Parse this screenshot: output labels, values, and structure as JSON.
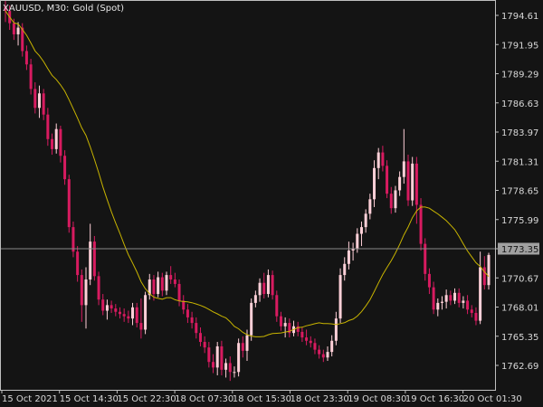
{
  "chart_data": {
    "type": "candlestick",
    "symbol": "XAUUSD",
    "timeframe": "M30",
    "instrument": "Gold (Spot)",
    "title_separator_1": ",",
    "title_separator_2": ":",
    "y_ticks": [
      "1794.61",
      "1791.95",
      "1789.29",
      "1786.63",
      "1783.97",
      "1781.31",
      "1778.65",
      "1775.99",
      "1773.35",
      "1770.67",
      "1768.01",
      "1765.35",
      "1762.69"
    ],
    "x_ticks": [
      "15 Oct 2021",
      "15 Oct 14:30",
      "15 Oct 22:30",
      "18 Oct 07:30",
      "18 Oct 15:30",
      "18 Oct 23:30",
      "19 Oct 08:30",
      "19 Oct 16:30",
      "20 Oct 01:30"
    ],
    "current_price": "1773.35",
    "ylim": [
      1761.0,
      1795.9
    ],
    "colors": {
      "background": "#141414",
      "bull": "#ffd0d8",
      "bear": "#d81b60",
      "ma_line": "#c8b400",
      "price_line": "#8a8a8a",
      "price_label_bg": "#a0a0a0",
      "frame": "#bfbfbf"
    },
    "moving_average_period": 20,
    "candles": [
      [
        1795.4,
        1795.9,
        1794.0,
        1795.0
      ],
      [
        1795.0,
        1795.5,
        1793.3,
        1793.9
      ],
      [
        1793.9,
        1794.3,
        1792.4,
        1792.9
      ],
      [
        1792.9,
        1794.0,
        1791.9,
        1793.5
      ],
      [
        1793.5,
        1793.9,
        1790.9,
        1791.4
      ],
      [
        1791.4,
        1791.9,
        1789.7,
        1790.2
      ],
      [
        1790.2,
        1790.7,
        1787.5,
        1788.0
      ],
      [
        1788.0,
        1788.6,
        1785.8,
        1786.3
      ],
      [
        1786.3,
        1788.3,
        1785.4,
        1787.6
      ],
      [
        1787.6,
        1788.0,
        1785.2,
        1785.7
      ],
      [
        1785.7,
        1786.3,
        1782.9,
        1783.5
      ],
      [
        1783.5,
        1784.0,
        1782.1,
        1782.6
      ],
      [
        1782.6,
        1784.9,
        1782.2,
        1784.4
      ],
      [
        1784.4,
        1784.7,
        1781.4,
        1782.0
      ],
      [
        1782.0,
        1782.5,
        1779.4,
        1779.9
      ],
      [
        1779.9,
        1780.3,
        1775.1,
        1775.6
      ],
      [
        1775.6,
        1776.1,
        1772.9,
        1773.4
      ],
      [
        1773.4,
        1773.9,
        1770.7,
        1771.3
      ],
      [
        1771.3,
        1771.8,
        1767.1,
        1768.6
      ],
      [
        1768.6,
        1772.0,
        1766.5,
        1770.9
      ],
      [
        1770.9,
        1775.9,
        1770.4,
        1774.3
      ],
      [
        1774.3,
        1774.8,
        1770.8,
        1771.2
      ],
      [
        1771.2,
        1771.6,
        1768.6,
        1769.1
      ],
      [
        1769.1,
        1769.6,
        1767.7,
        1768.1
      ],
      [
        1768.1,
        1769.1,
        1767.3,
        1768.6
      ],
      [
        1768.6,
        1769.0,
        1767.9,
        1768.3
      ],
      [
        1768.3,
        1768.7,
        1767.6,
        1768.0
      ],
      [
        1768.0,
        1768.4,
        1767.4,
        1767.8
      ],
      [
        1767.8,
        1768.3,
        1767.1,
        1767.6
      ],
      [
        1767.6,
        1768.1,
        1767.0,
        1767.4
      ],
      [
        1767.4,
        1768.8,
        1766.8,
        1768.4
      ],
      [
        1768.4,
        1768.8,
        1766.6,
        1767.0
      ],
      [
        1767.0,
        1769.2,
        1765.6,
        1766.4
      ],
      [
        1766.4,
        1769.8,
        1766.0,
        1769.5
      ],
      [
        1769.5,
        1771.4,
        1769.1,
        1770.9
      ],
      [
        1770.9,
        1771.3,
        1769.0,
        1769.6
      ],
      [
        1769.6,
        1771.6,
        1769.3,
        1771.1
      ],
      [
        1771.1,
        1771.5,
        1769.4,
        1769.9
      ],
      [
        1769.9,
        1771.6,
        1769.5,
        1771.3
      ],
      [
        1771.3,
        1772.1,
        1770.5,
        1770.9
      ],
      [
        1770.9,
        1771.5,
        1770.2,
        1770.5
      ],
      [
        1770.5,
        1770.9,
        1768.5,
        1769.0
      ],
      [
        1769.0,
        1769.5,
        1767.8,
        1768.2
      ],
      [
        1768.2,
        1768.7,
        1767.0,
        1767.5
      ],
      [
        1767.5,
        1768.0,
        1766.5,
        1767.0
      ],
      [
        1767.0,
        1767.5,
        1765.6,
        1766.1
      ],
      [
        1766.1,
        1766.6,
        1764.9,
        1765.3
      ],
      [
        1765.3,
        1765.8,
        1764.3,
        1764.8
      ],
      [
        1764.8,
        1765.3,
        1763.0,
        1763.5
      ],
      [
        1763.5,
        1764.2,
        1762.5,
        1763.0
      ],
      [
        1763.0,
        1765.3,
        1762.3,
        1764.9
      ],
      [
        1764.9,
        1765.4,
        1762.3,
        1762.8
      ],
      [
        1762.8,
        1763.8,
        1762.1,
        1763.4
      ],
      [
        1763.4,
        1764.0,
        1761.8,
        1762.6
      ],
      [
        1762.6,
        1763.1,
        1762.1,
        1762.6
      ],
      [
        1762.6,
        1765.6,
        1762.2,
        1765.2
      ],
      [
        1765.2,
        1765.8,
        1763.9,
        1764.5
      ],
      [
        1764.5,
        1766.4,
        1763.6,
        1765.9
      ],
      [
        1765.9,
        1769.2,
        1765.4,
        1768.8
      ],
      [
        1768.8,
        1769.9,
        1768.4,
        1769.5
      ],
      [
        1769.5,
        1771.0,
        1768.9,
        1770.6
      ],
      [
        1770.6,
        1771.5,
        1769.2,
        1769.6
      ],
      [
        1769.6,
        1771.8,
        1769.3,
        1771.3
      ],
      [
        1771.3,
        1771.7,
        1769.1,
        1769.5
      ],
      [
        1769.5,
        1769.9,
        1767.1,
        1767.6
      ],
      [
        1767.6,
        1768.0,
        1766.3,
        1766.7
      ],
      [
        1766.7,
        1767.5,
        1765.7,
        1767.0
      ],
      [
        1767.0,
        1767.4,
        1765.7,
        1766.1
      ],
      [
        1766.1,
        1767.2,
        1765.8,
        1766.7
      ],
      [
        1766.7,
        1767.1,
        1765.8,
        1766.2
      ],
      [
        1766.2,
        1766.6,
        1765.3,
        1765.7
      ],
      [
        1765.7,
        1766.4,
        1765.0,
        1765.4
      ],
      [
        1765.4,
        1765.8,
        1764.8,
        1765.2
      ],
      [
        1765.2,
        1765.6,
        1764.2,
        1764.6
      ],
      [
        1764.6,
        1765.0,
        1763.8,
        1764.2
      ],
      [
        1764.2,
        1764.6,
        1763.5,
        1763.9
      ],
      [
        1763.9,
        1764.9,
        1763.6,
        1764.4
      ],
      [
        1764.4,
        1765.9,
        1764.0,
        1765.4
      ],
      [
        1765.4,
        1768.0,
        1765.0,
        1767.4
      ],
      [
        1767.4,
        1771.9,
        1767.0,
        1771.3
      ],
      [
        1771.3,
        1772.9,
        1770.8,
        1772.3
      ],
      [
        1772.3,
        1774.3,
        1771.8,
        1773.5
      ],
      [
        1773.5,
        1774.2,
        1772.6,
        1773.7
      ],
      [
        1773.7,
        1775.5,
        1773.3,
        1775.0
      ],
      [
        1775.0,
        1776.1,
        1773.9,
        1775.6
      ],
      [
        1775.6,
        1777.2,
        1775.1,
        1776.8
      ],
      [
        1776.8,
        1778.6,
        1776.3,
        1778.1
      ],
      [
        1778.1,
        1781.6,
        1777.4,
        1780.9
      ],
      [
        1780.9,
        1782.7,
        1779.9,
        1782.3
      ],
      [
        1782.3,
        1782.9,
        1780.6,
        1781.1
      ],
      [
        1781.1,
        1781.6,
        1778.2,
        1778.6
      ],
      [
        1778.6,
        1779.2,
        1776.8,
        1777.3
      ],
      [
        1777.3,
        1779.3,
        1776.9,
        1778.9
      ],
      [
        1778.9,
        1780.6,
        1778.4,
        1780.1
      ],
      [
        1780.1,
        1784.4,
        1779.5,
        1781.5
      ],
      [
        1781.5,
        1782.1,
        1777.5,
        1778.0
      ],
      [
        1778.0,
        1781.9,
        1777.5,
        1781.3
      ],
      [
        1781.3,
        1781.9,
        1775.9,
        1777.6
      ],
      [
        1777.6,
        1778.2,
        1773.5,
        1774.1
      ],
      [
        1774.1,
        1774.6,
        1770.8,
        1771.4
      ],
      [
        1771.4,
        1771.9,
        1769.6,
        1770.2
      ],
      [
        1770.2,
        1770.7,
        1767.8,
        1768.2
      ],
      [
        1768.2,
        1769.2,
        1767.6,
        1768.8
      ],
      [
        1768.8,
        1769.4,
        1768.2,
        1768.9
      ],
      [
        1768.9,
        1770.0,
        1768.3,
        1769.5
      ],
      [
        1769.5,
        1769.9,
        1768.6,
        1769.0
      ],
      [
        1769.0,
        1770.1,
        1768.7,
        1769.7
      ],
      [
        1769.7,
        1770.1,
        1768.4,
        1768.8
      ],
      [
        1768.8,
        1769.4,
        1768.3,
        1769.0
      ],
      [
        1769.0,
        1769.5,
        1767.8,
        1768.2
      ],
      [
        1768.2,
        1768.6,
        1767.5,
        1767.9
      ],
      [
        1767.9,
        1768.4,
        1766.8,
        1767.2
      ],
      [
        1767.2,
        1773.4,
        1766.9,
        1772.0
      ],
      [
        1772.0,
        1773.0,
        1770.0,
        1770.4
      ],
      [
        1770.4,
        1773.3,
        1770.0,
        1773.1
      ]
    ]
  }
}
